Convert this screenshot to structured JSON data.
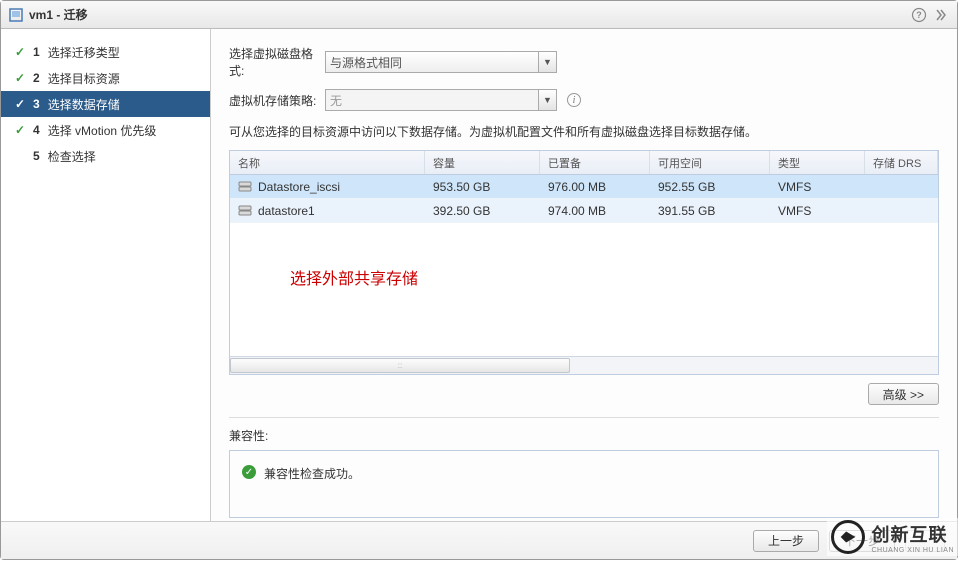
{
  "title": "vm1 - 迁移",
  "steps": [
    {
      "num": "1",
      "label": "选择迁移类型",
      "checked": true
    },
    {
      "num": "2",
      "label": "选择目标资源",
      "checked": true
    },
    {
      "num": "3",
      "label": "选择数据存储",
      "checked": true,
      "active": true
    },
    {
      "num": "4",
      "label": "选择 vMotion 优先级",
      "checked": true
    },
    {
      "num": "5",
      "label": "检查选择",
      "checked": false
    }
  ],
  "form": {
    "disk_format_label": "选择虚拟磁盘格式:",
    "disk_format_value": "与源格式相同",
    "storage_policy_label": "虚拟机存储策略:",
    "storage_policy_value": "无"
  },
  "description": "可从您选择的目标资源中访问以下数据存储。为虚拟机配置文件和所有虚拟磁盘选择目标数据存储。",
  "table": {
    "headers": {
      "name": "名称",
      "cap": "容量",
      "prov": "已置备",
      "free": "可用空间",
      "type": "类型",
      "drs": "存储 DRS"
    },
    "rows": [
      {
        "name": "Datastore_iscsi",
        "cap": "953.50 GB",
        "prov": "976.00 MB",
        "free": "952.55 GB",
        "type": "VMFS",
        "selected": true
      },
      {
        "name": "datastore1",
        "cap": "392.50 GB",
        "prov": "974.00 MB",
        "free": "391.55 GB",
        "type": "VMFS",
        "selected": false
      }
    ]
  },
  "annotation": "选择外部共享存储",
  "advanced_btn": "高级 >>",
  "compat": {
    "label": "兼容性:",
    "msg": "兼容性检查成功。"
  },
  "footer": {
    "back": "上一步",
    "next": "下一步"
  },
  "watermark": {
    "main": "创新互联",
    "sub": "CHUANG XIN HU LIAN"
  }
}
